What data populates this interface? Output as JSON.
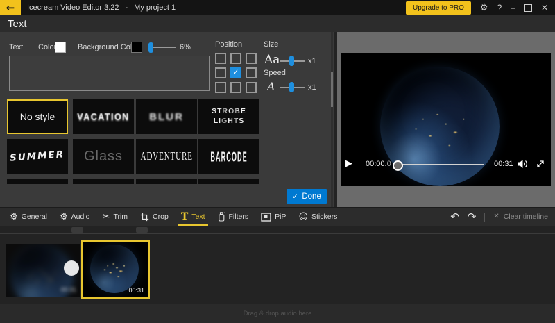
{
  "titlebar": {
    "app_title": "Icecream Video Editor 3.22",
    "separator": "-",
    "project_name": "My project 1",
    "upgrade_label": "Upgrade to PRO"
  },
  "icons": {
    "back": "←",
    "gear": "⚙",
    "help": "?",
    "minimize": "–",
    "close": "✕",
    "scissors": "✂",
    "text_tab": "T",
    "smiley": "☺",
    "undo": "↶",
    "redo": "↷",
    "clear": "✕",
    "play": "▶",
    "check": "✓"
  },
  "panel": {
    "title": "Text",
    "text_label": "Text",
    "color_label": "Color",
    "background_color_label": "Background Color",
    "background_opacity": "6%",
    "position_label": "Position",
    "size_label": "Size",
    "size_glyph": "Aa",
    "size_value": "x1",
    "speed_label": "Speed",
    "speed_glyph": "A",
    "speed_value": "x1",
    "done_label": "Done",
    "styles": [
      {
        "label": "No style"
      },
      {
        "label": "VACATION"
      },
      {
        "label": "BLUR"
      },
      {
        "label": "STROBE LIGHTS"
      },
      {
        "label": "SUMMER"
      },
      {
        "label": "Glass"
      },
      {
        "label": "ADVENTURE"
      },
      {
        "label": "BARCODE"
      }
    ]
  },
  "tabs": [
    {
      "label": "General"
    },
    {
      "label": "Audio"
    },
    {
      "label": "Trim"
    },
    {
      "label": "Crop"
    },
    {
      "label": "Text"
    },
    {
      "label": "Filters"
    },
    {
      "label": "PiP"
    },
    {
      "label": "Stickers"
    }
  ],
  "timeline_bar": {
    "clear_label": "Clear timeline"
  },
  "preview": {
    "current_time": "00:00.",
    "current_time_fraction": "0",
    "duration": "00:31"
  },
  "timeline": {
    "clip_duration": "00:31",
    "audio_hint": "Drag & drop audio here"
  },
  "colors": {
    "accent_yellow": "#f2c21c",
    "accent_blue": "#0079d1",
    "checkbox_blue": "#1e8fdf"
  }
}
